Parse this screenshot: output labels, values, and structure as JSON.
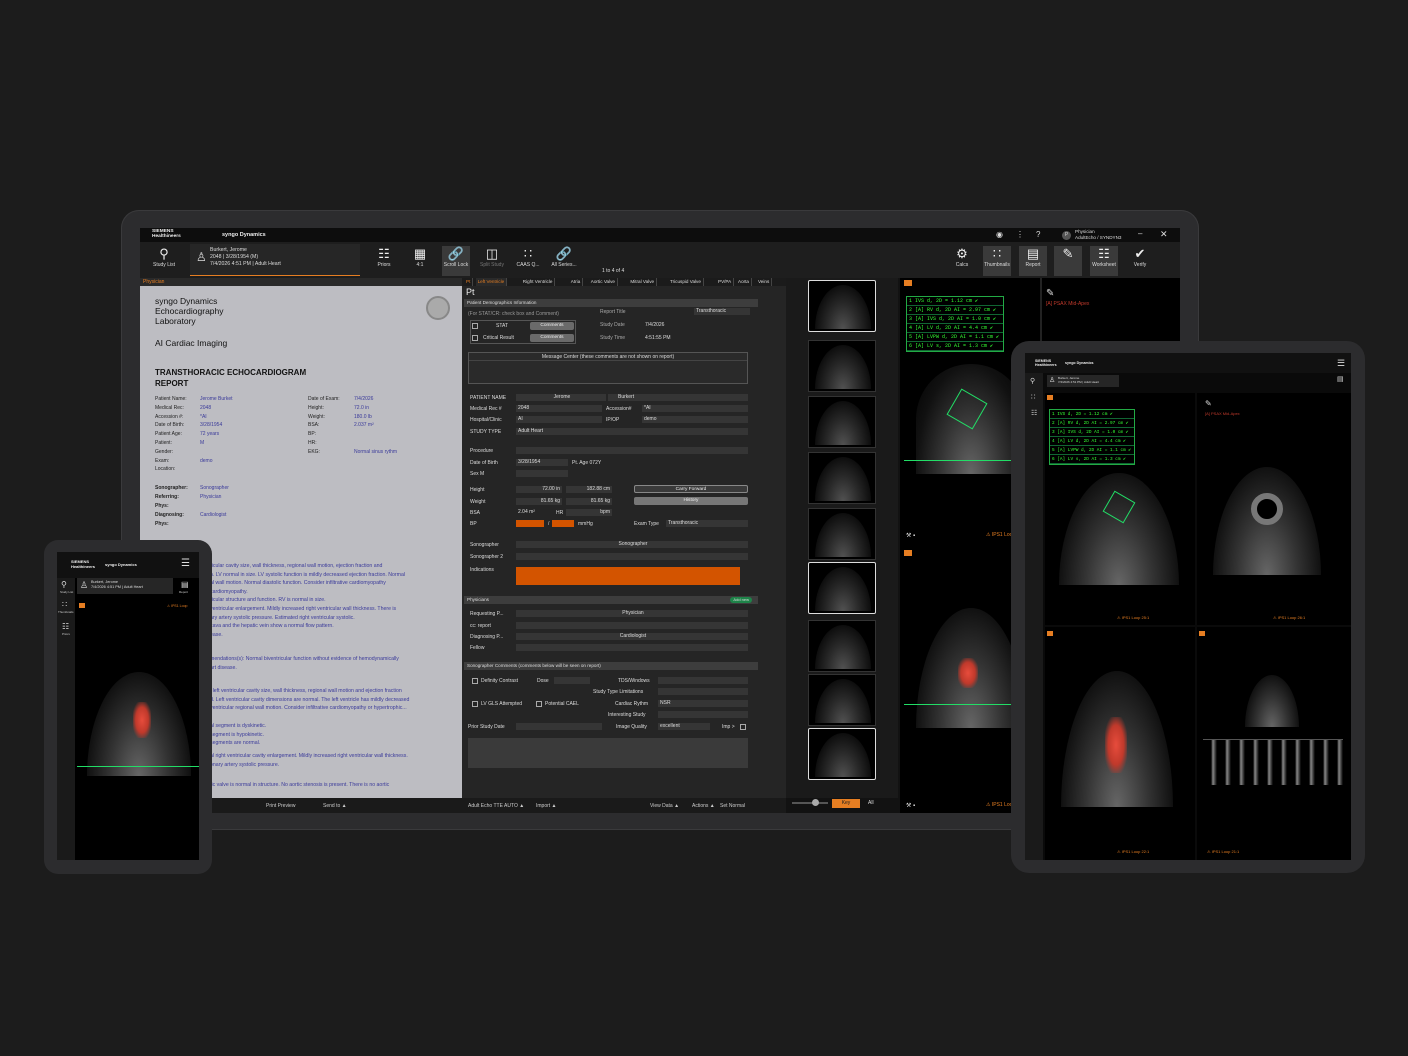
{
  "brand": {
    "company_top": "SIEMENS",
    "company_bottom": "Healthineers",
    "product": "syngo Dynamics"
  },
  "user": {
    "role": "Physician",
    "workstation": "AdultEcho / SYNDYN3",
    "initial": "P"
  },
  "patient": {
    "name": "Burkert, Jerome",
    "id_dob": "2048 | 3/28/1954 (M)",
    "study": "7/4/2026 4:51 PM | Adult Heart"
  },
  "toolbar": {
    "study_list": "Study List",
    "priors": "Priors",
    "layout": "4:1",
    "scroll_lock": "Scroll Lock",
    "split_study": "Split Study",
    "caas": "CAAS Q...",
    "all_series": "All Series...",
    "counter": "1 to 4 of 4",
    "calcs": "Calcs",
    "thumbnails": "Thumbnails",
    "report": "Report",
    "worksheet": "Worksheet",
    "verify": "Verify"
  },
  "report": {
    "tab": "Physician",
    "lab_line1": "syngo Dynamics",
    "lab_line2": "Echocardiography",
    "lab_line3": "Laboratory",
    "subtitle": "AI Cardiac Imaging",
    "title_line1": "TRANSTHORACIC ECHOCARDIOGRAM",
    "title_line2": "REPORT",
    "left_labels": [
      "Patient Name:",
      "Medical Rec:",
      "Accession #:",
      "Date of Birth:",
      "Patient Age:",
      "Patient:",
      "Gender:",
      "Exam:",
      "Location:"
    ],
    "left_values": [
      "Jerome Burket",
      "2048",
      "*AI",
      "3/28/1954",
      "72 years",
      "M",
      "",
      "demo",
      ""
    ],
    "right_labels": [
      "Date of Exam:",
      "Height:",
      "Weight:",
      "BSA:",
      "BP:",
      "HR:",
      "EKG:"
    ],
    "right_values": [
      "7/4/2026",
      "72.0 in",
      "180.0 lb",
      "2.037 m²",
      "",
      "",
      "Normal sinus rythm"
    ],
    "staff_labels": [
      "Sonographer:",
      "Referring:",
      "Phys:",
      "Diagnosing:",
      "Phys:"
    ],
    "staff_values": [
      "Sonographer",
      "Physician",
      "",
      "Cardiologist",
      ""
    ],
    "findings": [
      "ricular cavity size, wall thickness, regional wall motion, ejection fraction and",
      "n. LV normal in size. LV systolic function is mildly decreased ejection fraction. Normal",
      "al wall motion. Normal diastolic function. Consider infiltrative cardiomyopathy",
      "cardiomyopathy.",
      "ricular structure and function. RV is normal in size.",
      "ventricular enlargement. Mildly increased right ventricular wall thickness. There is",
      "ary artery systolic pressure. Estimated right ventricular systolic.",
      "cava and the hepatic vein show a normal flow pattern.",
      "ease."
    ],
    "recommendations": [
      "mendations(s): Normal biventricular function without evidence of hemodynamically",
      "art disease."
    ],
    "findings2": [
      "l left ventricular cavity size, wall thickness, regional wall motion and ejection fraction",
      "d. Left ventricular cavity dimensions are normal. The left ventricle has mildly decreased",
      "ventricular regional wall motion. Consider infiltrative cardiomyopathy or hypertrophic..."
    ],
    "findings3": [
      "al segment is dyskinetic.",
      "segment is hypokinetic.",
      "segments are normal."
    ],
    "findings4": [
      "al right ventricular cavity enlargement. Mildly increased right ventricular wall thickness.",
      "onary artery systolic pressure."
    ],
    "findings5": [
      "tic valve is normal in structure. No aortic stenosis is present. There is no aortic"
    ]
  },
  "form": {
    "tabs": [
      "Pt",
      "Left Ventricle",
      "Right Ventricle",
      "Atria",
      "Aortic Valve",
      "Mitral Valve",
      "Tricuspid Valve",
      "PV/PA",
      "Aorta",
      "Veins"
    ],
    "pt_header": "Pt",
    "section_demo": "Patient Demographics Information",
    "stat_note": "(For STAT/CR: check box and Comment)",
    "stat": "STAT",
    "critical": "Critical Result",
    "comments": "Comments",
    "report_title_label": "Report Title",
    "report_title_value": "Transthoracic",
    "study_date_label": "Study Date",
    "study_date_value": "7/4/2026",
    "study_time_label": "Study Time",
    "study_time_value": "4:51:55 PM",
    "message_center": "Message Center (these comments are not shown on report)",
    "patient_name_label": "PATIENT NAME",
    "first": "Jerome",
    "last": "Burkert",
    "mrn_label": "Medical Rec #",
    "mrn": "2048",
    "accession_label": "Accession#",
    "accession": "*AI",
    "hospital_label": "Hospital/Clinic",
    "hospital": "AI",
    "ipop_label": "IP/OP",
    "ipop": "demo",
    "study_type_label": "STUDY TYPE",
    "study_type": "Adult Heart",
    "procedure_label": "Procedure",
    "dob_label": "Date of Birth",
    "dob": "3/28/1954",
    "age": "Pt. Age 072Y",
    "sex_label": "Sex M",
    "height_label": "Height",
    "height_in": "72.00 in",
    "height_cm": "182.88 cm",
    "weight_label": "Weight",
    "weight_kg": "81.65 kg",
    "weight_lb": "81.65 kg",
    "bsa_label": "BSA",
    "bsa": "2.04 m²",
    "hr_label": "HR",
    "bpm": "bpm",
    "bp_label": "BP",
    "mmhg": "mmHg",
    "slash": "/",
    "carry_forward": "Carry Forward",
    "history": "History",
    "exam_type_label": "Exam Type",
    "exam_type": "Transthoracic",
    "sonographer_label": "Sonographer",
    "sonographer": "Sonographer",
    "sonographer2_label": "Sonographer 2",
    "indications_label": "Indications",
    "section_phys": "Physicians",
    "add_new": "Add new",
    "requesting_label": "Requesting P...",
    "requesting": "Physician",
    "cc_label": "cc: report",
    "diagnosing_label": "Diagnosing P...",
    "diagnosing": "Cardiologist",
    "fellow_label": "Fellow",
    "section_sono": "Sonographer Comments (comments below will be seen on report)",
    "definity": "Definity Contrast",
    "dose": "Dose",
    "tds": "TDS/Windows",
    "study_type_lim": "Study Type Limitations",
    "lv_gls": "LV GLS Attempted",
    "potential_cael": "Potential CAEL",
    "cardiac_rythm": "Cardiac Rythm",
    "nsr": "NSR",
    "interesting": "Interesting Study",
    "prior_date": "Prior Study Date",
    "image_quality": "Image Quality",
    "excellent": "excellent",
    "imp": "Imp >"
  },
  "statusbar": {
    "print_preview": "Print Preview",
    "send_to": "Send to",
    "template": "Adult Echo TTE AUTO",
    "import": "Import",
    "view_data": "View Data",
    "actions": "Actions",
    "set_normal": "Set Normal",
    "key": "Key",
    "all": "All"
  },
  "measurements": [
    {
      "n": "1",
      "q": "",
      "label": "IVS d, 2D = 1.12 cm"
    },
    {
      "n": "2",
      "q": "[A]",
      "label": "RV d, 2D AI = 2.97 cm"
    },
    {
      "n": "3",
      "q": "[A]",
      "label": "IVS d, 2D AI = 1.0 cm"
    },
    {
      "n": "4",
      "q": "[A]",
      "label": "LV d, 2D AI = 4.4 cm"
    },
    {
      "n": "5",
      "q": "[A]",
      "label": "LVPW d, 2D AI = 1.1 cm"
    },
    {
      "n": "6",
      "q": "[A]",
      "label": "LV s, 2D AI = 1.3 cm"
    }
  ],
  "viewer": {
    "view_label": "[A] PSAX Mid-Apex",
    "loop_label": "IPS1 Loop",
    "loop_label_2": "IPS1 Loop 25:1",
    "loop_label_3": "IPS1 Loop 26:1",
    "loop_label_4": "IPS1 Loop 22:1",
    "loop_label_5": "IPS1 Loop 21:1"
  },
  "colors": {
    "accent": "#e67e22",
    "measure": "#33ee33",
    "report_text": "#3a3a9a",
    "bg": "#1c1c1c"
  },
  "icons": [
    "study-list-icon",
    "priors-icon",
    "layout-grid-icon",
    "scroll-lock-icon",
    "split-study-icon",
    "caas-icon",
    "all-series-icon",
    "calcs-icon",
    "thumbnails-icon",
    "report-icon",
    "worksheet-icon",
    "verify-icon",
    "bell-icon",
    "more-icon",
    "help-icon",
    "minimize-icon",
    "close-icon",
    "hamburger-icon"
  ]
}
